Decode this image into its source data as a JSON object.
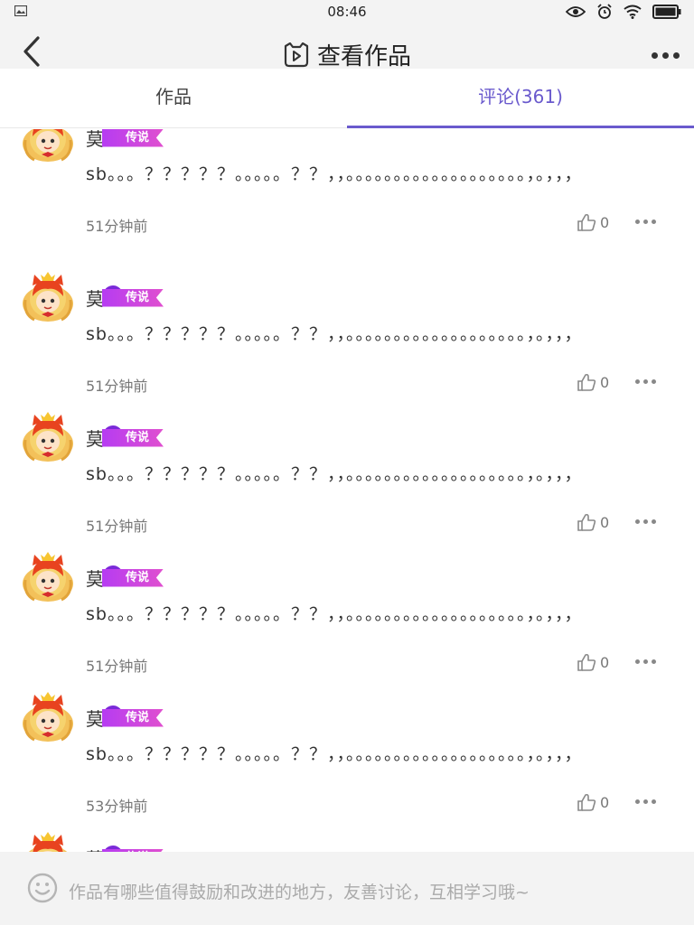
{
  "status": {
    "time": "08:46"
  },
  "header": {
    "title": "查看作品",
    "back_icon": "back-chevron-icon",
    "more_icon": "more-dots-icon"
  },
  "tabs": [
    {
      "label": "作品",
      "active": false
    },
    {
      "label": "评论(361)",
      "active": true
    }
  ],
  "comments": [
    {
      "name": "莫",
      "badge": "传说",
      "text": "sb。。。？？？？？。。。。。？？，，。。。。。。。。。。。。。。。。。。。，。，，，",
      "time": "51分钟前",
      "likes": "0"
    },
    {
      "name": "莫",
      "badge": "传说",
      "text": "sb。。。？？？？？。。。。。？？，，。。。。。。。。。。。。。。。。。。。，。，，，",
      "time": "51分钟前",
      "likes": "0"
    },
    {
      "name": "莫",
      "badge": "传说",
      "text": "sb。。。？？？？？。。。。。？？，，。。。。。。。。。。。。。。。。。。。，。，，，",
      "time": "51分钟前",
      "likes": "0"
    },
    {
      "name": "莫",
      "badge": "传说",
      "text": "sb。。。？？？？？。。。。。？？，，。。。。。。。。。。。。。。。。。。。，。，，，",
      "time": "51分钟前",
      "likes": "0"
    },
    {
      "name": "莫",
      "badge": "传说",
      "text": "sb。。。？？？？？。。。。。？？，，。。。。。。。。。。。。。。。。。。。，。，，，",
      "time": "53分钟前",
      "likes": "0"
    },
    {
      "name": "莫",
      "badge": "传说",
      "text": "",
      "time": "",
      "likes": ""
    }
  ],
  "input": {
    "placeholder": "作品有哪些值得鼓励和改进的地方，友善讨论，互相学习哦~",
    "emoji_icon": "smiley-icon"
  },
  "colors": {
    "accent": "#6a5acd",
    "badge": "#c044e6"
  }
}
